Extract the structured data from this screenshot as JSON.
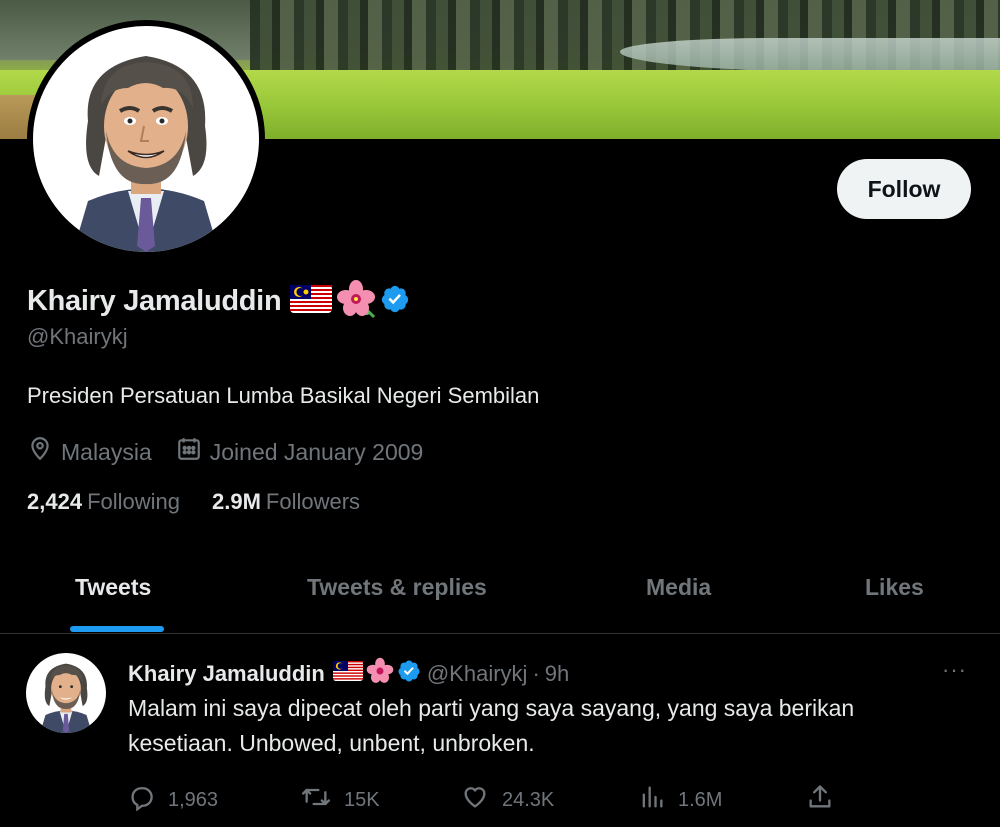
{
  "profile": {
    "name": "Khairy Jamaluddin",
    "handle": "@Khairykj",
    "bio": "Presiden Persatuan Lumba Basikal Negeri Sembilan",
    "location": "Malaysia",
    "joined": "Joined January 2009",
    "follow_label": "Follow",
    "following_count": "2,424",
    "following_label": "Following",
    "followers_count": "2.9M",
    "followers_label": "Followers",
    "verified_color": "#1d9bf0"
  },
  "tabs": [
    {
      "label": "Tweets",
      "active": true
    },
    {
      "label": "Tweets & replies",
      "active": false
    },
    {
      "label": "Media",
      "active": false
    },
    {
      "label": "Likes",
      "active": false
    }
  ],
  "tweet": {
    "name": "Khairy Jamaluddin",
    "handle": "@Khairykj",
    "separator": "·",
    "time": "9h",
    "more": "···",
    "text": "Malam ini saya dipecat oleh parti yang saya sayang, yang saya berikan kesetiaan. Unbowed, unbent, unbroken.",
    "replies": "1,963",
    "retweets": "15K",
    "likes": "24.3K",
    "views": "1.6M"
  },
  "icons": {
    "location": "location-pin-icon",
    "calendar": "calendar-icon",
    "reply": "reply-icon",
    "retweet": "retweet-icon",
    "like": "heart-icon",
    "views": "views-chart-icon",
    "share": "share-icon"
  },
  "accent_color": "#1d9bf0"
}
